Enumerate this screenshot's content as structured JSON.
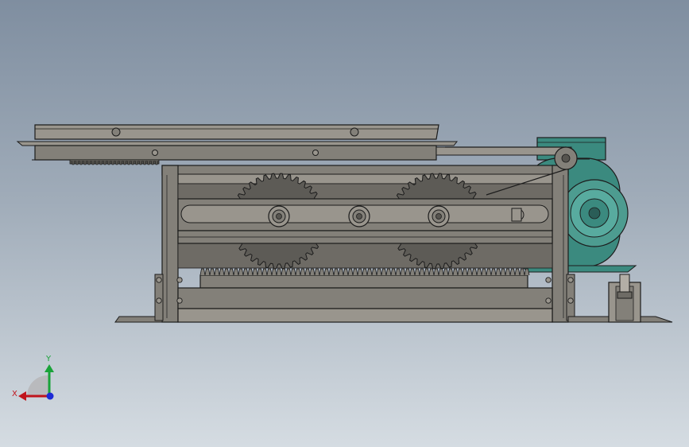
{
  "viewport": {
    "background_top": "#7f8ea0",
    "background_bottom": "#d5dce2",
    "model_name": ""
  },
  "colors": {
    "steel": "#838079",
    "steel_light": "#99958d",
    "steel_dark": "#56544f",
    "gear": "#5d5b56",
    "motor": "#3b8a7f",
    "motor_light": "#58ab9f",
    "edge": "#1c1c1c"
  },
  "triad": {
    "x_label": "X",
    "y_label": "Y",
    "x_color": "#c0141c",
    "y_color": "#19a339",
    "z_color": "#1d2bd6"
  }
}
